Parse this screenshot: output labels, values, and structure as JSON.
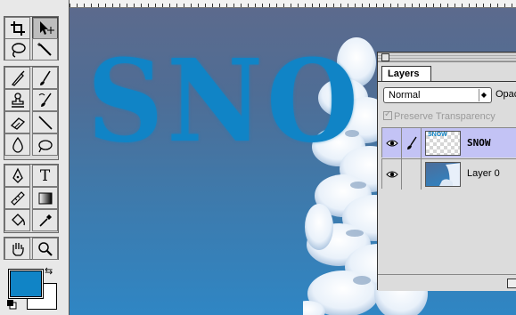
{
  "canvas": {
    "title_text": "SNO",
    "title_color": "#1084c6"
  },
  "toolbox": {
    "tools": [
      {
        "name": "crop-icon",
        "selected": false
      },
      {
        "name": "move-icon",
        "selected": true
      },
      {
        "name": "lasso-icon",
        "selected": false
      },
      {
        "name": "magic-wand-icon",
        "selected": false
      },
      {
        "name": "airbrush-icon",
        "selected": false
      },
      {
        "name": "paintbrush-icon",
        "selected": false
      },
      {
        "name": "rubber-stamp-icon",
        "selected": false
      },
      {
        "name": "history-brush-icon",
        "selected": false
      },
      {
        "name": "eraser-icon",
        "selected": false
      },
      {
        "name": "line-icon",
        "selected": false
      },
      {
        "name": "blur-icon",
        "selected": false
      },
      {
        "name": "dodge-icon",
        "selected": false
      },
      {
        "name": "pen-icon",
        "selected": false
      },
      {
        "name": "type-icon",
        "selected": false
      },
      {
        "name": "measure-icon",
        "selected": false
      },
      {
        "name": "gradient-icon",
        "selected": false
      },
      {
        "name": "paint-bucket-icon",
        "selected": false
      },
      {
        "name": "eyedropper-icon",
        "selected": false
      },
      {
        "name": "hand-icon",
        "selected": false
      },
      {
        "name": "zoom-icon",
        "selected": false
      }
    ],
    "type_tool_glyph": "T",
    "foreground_color": "#1084c6",
    "background_color": "#ffffff"
  },
  "layers_panel": {
    "tab_label": "Layers",
    "blend_mode": "Normal",
    "opacity_label": "Opac",
    "preserve_transparency_label": "Preserve Transparency",
    "preserve_transparency_checked": true,
    "layers": [
      {
        "name": "SNOW",
        "thumb_text": "SNOW",
        "active": true,
        "visible": true
      },
      {
        "name": "Layer 0",
        "active": false,
        "visible": true
      }
    ]
  }
}
